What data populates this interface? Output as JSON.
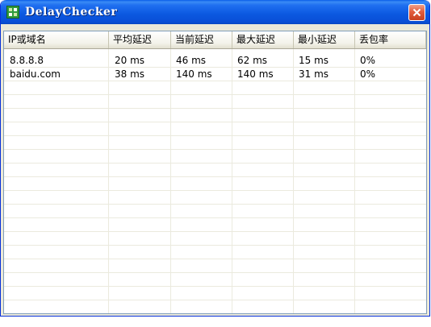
{
  "window": {
    "title": "DelayChecker"
  },
  "table": {
    "columns": [
      "IP或域名",
      "平均延迟",
      "当前延迟",
      "最大延迟",
      "最小延迟",
      "丢包率"
    ],
    "rows": [
      [
        "8.8.8.8",
        "20 ms",
        "46 ms",
        "62 ms",
        "15 ms",
        "0%"
      ],
      [
        "baidu.com",
        "38 ms",
        "140 ms",
        "140 ms",
        "31 ms",
        "0%"
      ]
    ]
  }
}
